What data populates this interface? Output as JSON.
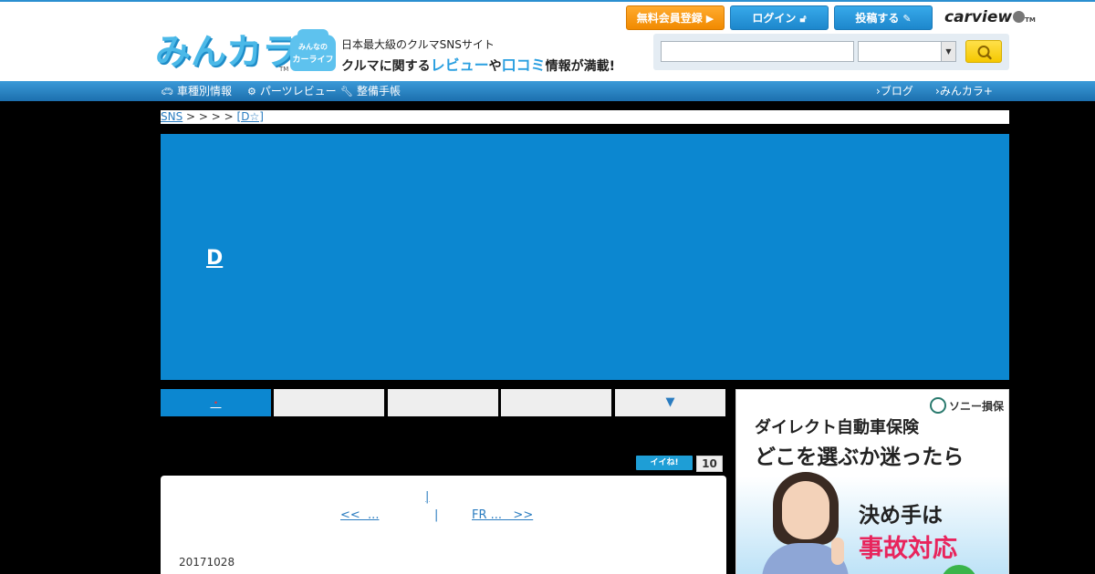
{
  "header": {
    "logo_text": "みんカラ",
    "logo_tm": "TM",
    "car_badge_line1": "みんなの",
    "car_badge_line2": "カーライフ",
    "tagline_small": "日本最大級のクルマSNSサイト",
    "tagline_pre": "クルマに関する",
    "tagline_review": "レビュー",
    "tagline_mid": "や",
    "tagline_kuchikomi": "口コミ",
    "tagline_post": "情報が満載!",
    "register_label": "無料会員登録",
    "login_label": "ログイン",
    "post_label": "投稿する",
    "carview_label": "carview",
    "carview_tm": "TM",
    "search_placeholder": "",
    "search_select_value": ""
  },
  "nav": {
    "car_info": "車種別情報",
    "parts_review": "パーツレビュー",
    "maintenance": "整備手帳",
    "blog": "ブログ",
    "minkara_plus": "みんカラ+"
  },
  "breadcrumb": {
    "root": "SNS",
    "separators": " > > > > ",
    "current": "[D☆]"
  },
  "banner": {
    "title": "D"
  },
  "tabs": [
    {
      "label": ""
    },
    {
      "label": ""
    },
    {
      "label": ""
    },
    {
      "label": ""
    },
    {
      "label": "▼"
    }
  ],
  "tab_marker": "・",
  "like": {
    "label": "イイね!",
    "count": "10"
  },
  "article": {
    "top_link": "|",
    "prev_link": "<<  ...",
    "mid": "|",
    "next_link": "FR ...   >>",
    "date": "20171028"
  },
  "ad": {
    "brand": "ソニー損保",
    "line1": "ダイレクト自動車保険",
    "line2": "どこを選ぶか迷ったら",
    "line3": "決め手は",
    "line4": "事故対応"
  },
  "colors": {
    "accent_blue": "#0c87d0",
    "register_orange": "#f18a00",
    "search_yellow": "#f5c800",
    "ad_pink": "#e8245c"
  }
}
